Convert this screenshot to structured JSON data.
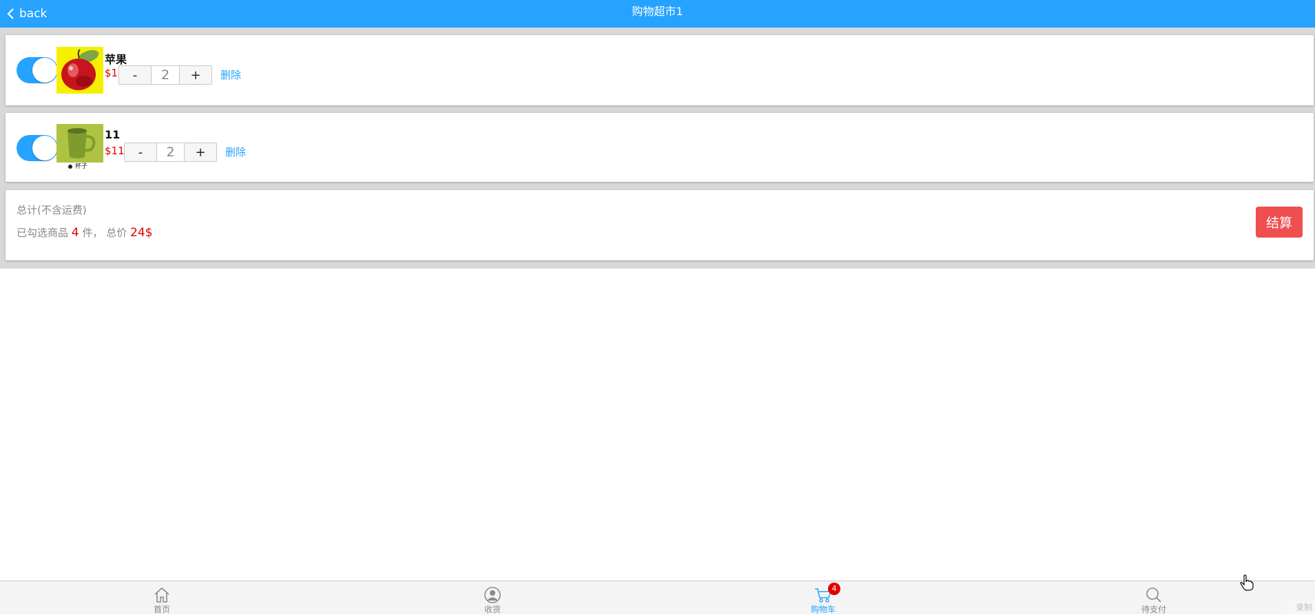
{
  "header": {
    "back_label": "back",
    "title": "购物超市1"
  },
  "cart": {
    "items": [
      {
        "name": "苹果",
        "price": "$1",
        "quantity": "2",
        "minus": "-",
        "plus": "+",
        "delete": "删除",
        "checked": true,
        "image_caption": ""
      },
      {
        "name": "11",
        "price": "$11",
        "quantity": "2",
        "minus": "-",
        "plus": "+",
        "delete": "删除",
        "checked": true,
        "image_caption": "杯子"
      }
    ],
    "total": {
      "label": "总计(不含运费)",
      "selected_prefix": "已勾选商品",
      "selected_count": "4",
      "selected_unit": "件，",
      "price_prefix": "总价",
      "price_value": "24$"
    },
    "checkout_label": "结算"
  },
  "tabbar": {
    "tabs": [
      {
        "label": "首页",
        "icon": "home-icon",
        "active": false
      },
      {
        "label": "收货",
        "icon": "user-icon",
        "active": false
      },
      {
        "label": "购物车",
        "icon": "cart-icon",
        "active": true,
        "badge": "4"
      },
      {
        "label": "待支付",
        "icon": "search-icon",
        "active": false
      }
    ]
  },
  "watermark": "录制",
  "colors": {
    "accent": "#26a2ff",
    "price": "#e00000",
    "checkout": "#ef4f4f"
  }
}
